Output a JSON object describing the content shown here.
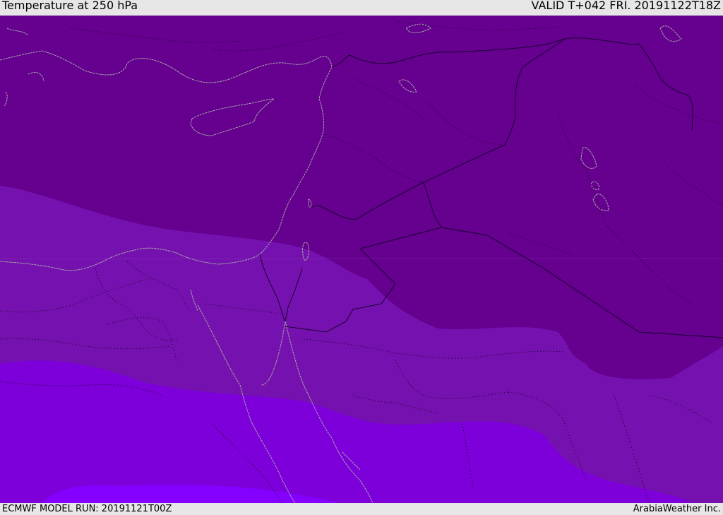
{
  "header": {
    "title": "Temperature at 250 hPa",
    "valid": "VALID T+042 FRI. 20191122T18Z"
  },
  "footer": {
    "model_run": "ECMWF MODEL RUN: 20191121T00Z",
    "credit": "ArabiaWeather Inc."
  },
  "map": {
    "colors": {
      "band_darkest": "#65008f",
      "band_mid": "#7512af",
      "band_light": "#7d00db",
      "band_lightest": "#8400ff",
      "coastline": "#a8a8a8",
      "border": "#1a0030",
      "border_dotted": "#2a0040"
    }
  }
}
